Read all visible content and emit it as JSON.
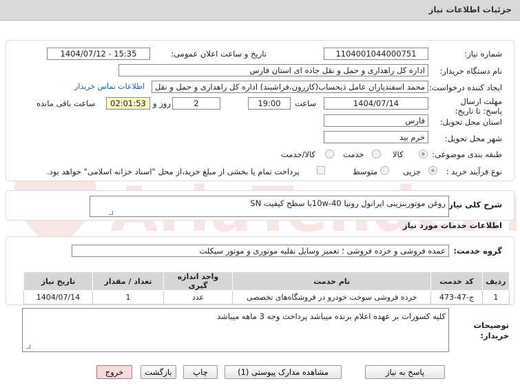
{
  "header": {
    "title": "جزئیات اطلاعات نیاز"
  },
  "watermark": {
    "text": "AriaTender.net"
  },
  "form": {
    "need_number_label": "شماره نیاز:",
    "need_number": "1104001044000751",
    "announce_label": "تاریخ و ساعت اعلان عمومی:",
    "announce_value": "1404/07/12 - 15:35",
    "buyer_org_label": "نام دستگاه خریدار:",
    "buyer_org": "اداره کل راهداری و حمل و نقل جاده ای استان فارس",
    "creator_label": "ایجاد کننده درخواست:",
    "creator": "محمد اسفندیاران عامل ذیحساب(کازرون،فراشبند) اداره کل راهداری و حمل و نقل",
    "contact_link": "اطلاعات تماس خریدار",
    "deadline_label": "مهلت ارسال پاسخ: تا تاریخ:",
    "deadline_date": "1404/07/14",
    "time_label": "ساعت",
    "deadline_time": "19:00",
    "days_value": "2",
    "days_label": "روز و",
    "remaining_time": "02:01:53",
    "remaining_label": "ساعت باقی مانده",
    "province_label": "استان محل تحویل:",
    "province": "فارس",
    "city_label": "شهر محل تحویل:",
    "city": "خرم بید",
    "category_label": "طبقه بندی موضوعی:",
    "category_options": [
      "کالا",
      "خدمت",
      "کالا/خدمت"
    ],
    "process_label": "نوع فرآیند خرید :",
    "process_options": [
      "جزیی",
      "متوسط"
    ],
    "payment_note": "پرداخت تمام یا بخشی از مبلغ خرید،از محل \"اسناد خزانه اسلامی\" خواهد بود."
  },
  "summary": {
    "label": "شرح کلی نیاز:",
    "value": "روغن موتوربنزینی ایرانول رونیا     10w-40با سطح کیفیت SN"
  },
  "services": {
    "section_title": "اطلاعات خدمات مورد نیاز",
    "group_label": "گروه خدمت:",
    "group_value": "عمده فروشی و خرده فروشی ؛ تعمیر وسایل نقلیه موتوری و موتور سیکلت",
    "columns": [
      "ردیف",
      "کد خدمت",
      "نام خدمت",
      "واحد اندازه گیری",
      "تعداد / مقدار",
      "تاریخ نیاز"
    ],
    "rows": [
      [
        "1",
        "ج-47-473",
        "خرده فروشی سوخت خودرو در فروشگاه‌های تخصصی",
        "عدد",
        "1",
        "1404/07/14"
      ]
    ]
  },
  "notes": {
    "label": "توضیحات خریدار:",
    "value": "کلیه کسورات بر عهده اعلام برنده میباشد پرداخت وجه 3 ماهه میباشد"
  },
  "buttons": {
    "reply": "پاسخ به نیاز",
    "docs": "مشاهده مدارک پیوستی (1)",
    "print": "چاپ",
    "back": "بازگشت",
    "exit": "خروج"
  },
  "colors": {
    "accent_link": "#1a5fb4",
    "remaining_bg": "#fff9c4",
    "exit_bg": "#f7dada"
  }
}
